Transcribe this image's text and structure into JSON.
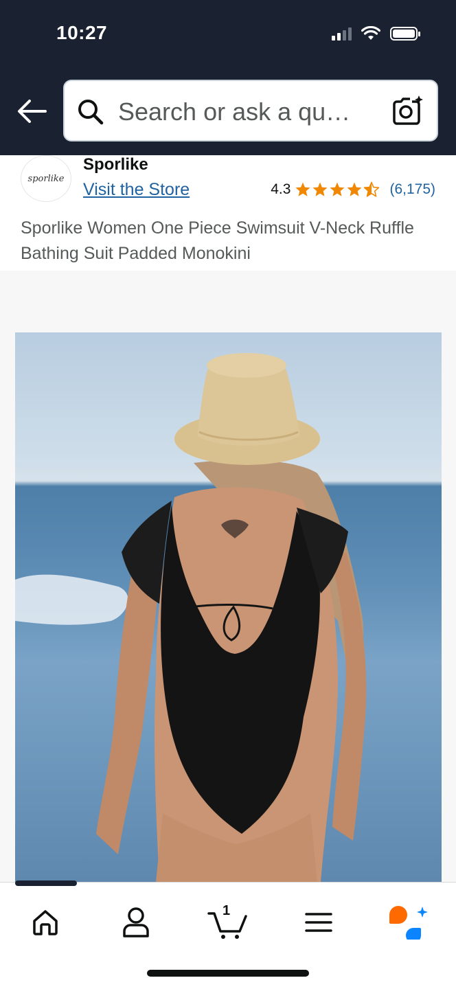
{
  "status_bar": {
    "time": "10:27"
  },
  "header": {
    "search_placeholder": "Search or ask a qu…"
  },
  "brand": {
    "logo_text": "sporlike",
    "name": "Sporlike",
    "visit_store_label": "Visit the Store",
    "rating": "4.3",
    "stars_out_of_5": 4.3,
    "rating_count": "(6,175)"
  },
  "product": {
    "title": "Sporlike Women One Piece Swimsuit V-Neck Ruffle Bathing Suit Padded Monokini"
  },
  "bottom_nav": {
    "items": [
      "home",
      "account",
      "cart",
      "menu",
      "rufus"
    ],
    "cart_count": "1"
  },
  "colors": {
    "header_bg": "#1a2130",
    "link": "#2162a1",
    "star": "#f08804",
    "rufus_orange": "#ff6a00",
    "rufus_blue": "#0a84ff"
  }
}
